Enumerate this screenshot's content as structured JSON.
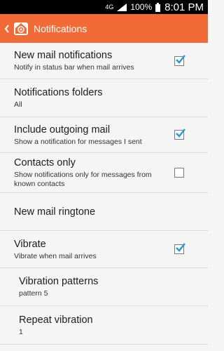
{
  "status_bar": {
    "network_label": "4G",
    "battery": "100%",
    "time": "8:01 PM"
  },
  "app_bar": {
    "title": "Notifications",
    "accent": "#f26b37"
  },
  "settings": [
    {
      "title": "New mail notifications",
      "subtitle": "Notify in status bar when mail arrives",
      "checkbox": true,
      "checked": true
    },
    {
      "title": "Notifications folders",
      "subtitle": "All",
      "checkbox": false
    },
    {
      "title": "Include outgoing mail",
      "subtitle": "Show a notification for messages I sent",
      "checkbox": true,
      "checked": true
    },
    {
      "title": "Contacts only",
      "subtitle": "Show notifications only for messages from known contacts",
      "checkbox": true,
      "checked": false
    },
    {
      "title": "New mail ringtone",
      "subtitle": "",
      "checkbox": false
    },
    {
      "title": "Vibrate",
      "subtitle": "Vibrate when mail arrives",
      "checkbox": true,
      "checked": true
    },
    {
      "title": "Vibration patterns",
      "subtitle": "pattern 5",
      "checkbox": false,
      "indent": true
    },
    {
      "title": "Repeat vibration",
      "subtitle": "1",
      "checkbox": false,
      "indent": true
    }
  ]
}
